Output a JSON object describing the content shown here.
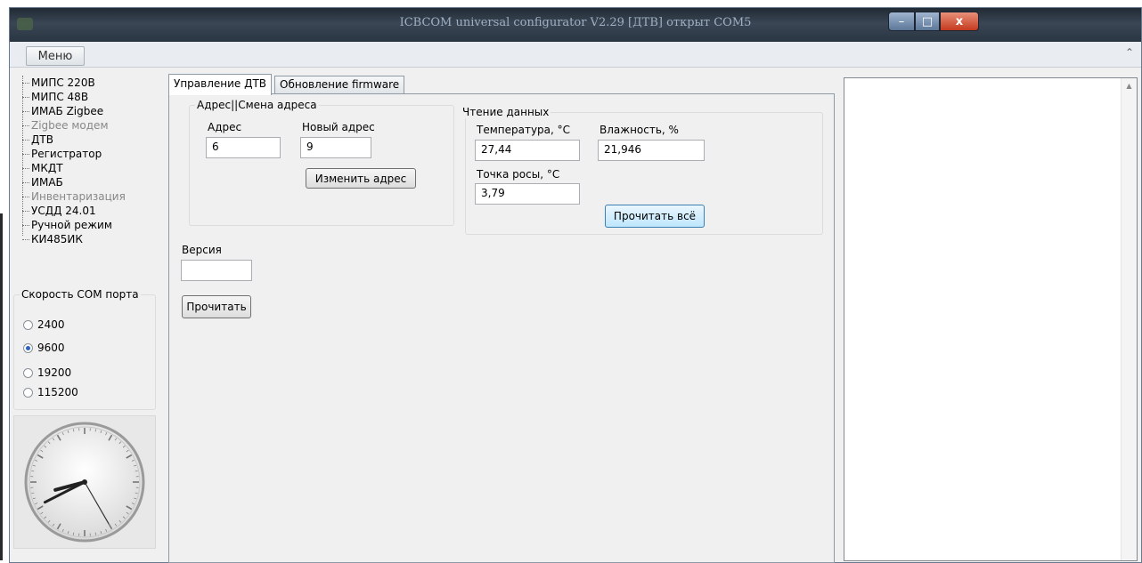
{
  "window": {
    "title": "ICBCOM universal configurator V2.29 [ДТВ] открыт COM5",
    "min_glyph": "–",
    "max_glyph": "□",
    "close_glyph": "x"
  },
  "menu": {
    "label": "Меню",
    "collapse_glyph": "⌃"
  },
  "device_tree": [
    {
      "label": "МИПС 220В",
      "dimmed": false
    },
    {
      "label": "МИПС 48В",
      "dimmed": false
    },
    {
      "label": "ИМАБ Zigbee",
      "dimmed": false
    },
    {
      "label": "Zigbee модем",
      "dimmed": true
    },
    {
      "label": "ДТВ",
      "dimmed": false
    },
    {
      "label": "Регистратор",
      "dimmed": false
    },
    {
      "label": "МКДТ",
      "dimmed": false
    },
    {
      "label": "ИМАБ",
      "dimmed": false
    },
    {
      "label": "Инвентаризация",
      "dimmed": true
    },
    {
      "label": "УСДД 24.01",
      "dimmed": false
    },
    {
      "label": "Ручной режим",
      "dimmed": false
    },
    {
      "label": "КИ485ИК",
      "dimmed": false
    }
  ],
  "com_speed": {
    "title": "Скорость COM порта",
    "options": [
      "2400",
      "9600",
      "19200",
      "115200"
    ],
    "selected": "9600"
  },
  "clock": {
    "hour_angle_deg": 255,
    "minute_angle_deg": 243,
    "second_angle_deg": 150
  },
  "tabs": [
    {
      "label": "Управление ДТВ",
      "active": true
    },
    {
      "label": "Обновление firmware",
      "active": false
    }
  ],
  "address_group": {
    "title": "Адрес||Смена адреса",
    "address_label": "Адрес",
    "address_value": "6",
    "new_address_label": "Новый адрес",
    "new_address_value": "9",
    "change_button": "Изменить адрес"
  },
  "read_group": {
    "title": "Чтение данных",
    "temperature_label": "Температура, °С",
    "temperature_value": "27,44",
    "humidity_label": "Влажность, %",
    "humidity_value": "21,946",
    "dewpoint_label": "Точка росы, °С",
    "dewpoint_value": "3,79",
    "read_all_button": "Прочитать всё"
  },
  "version": {
    "label": "Версия",
    "value": "",
    "read_button": "Прочитать"
  },
  "log": {
    "text": "",
    "scroll_up_glyph": "▲"
  }
}
